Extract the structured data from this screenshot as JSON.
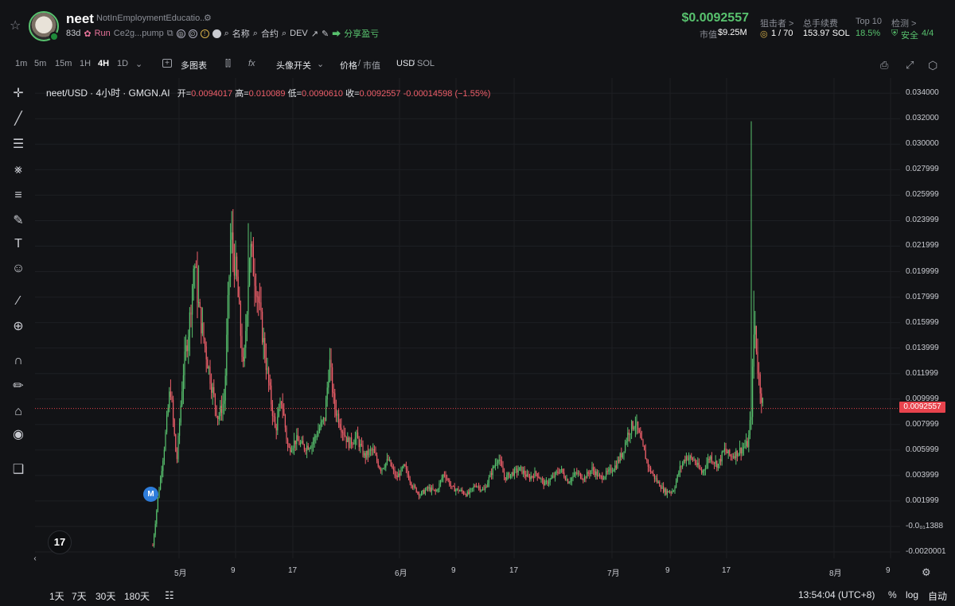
{
  "header": {
    "symbol": "neet",
    "full_name": "NotInEmploymentEducatio...",
    "age": "83d",
    "launchpad": "Run",
    "contract": "Ce2g...pump",
    "links": [
      "名称",
      "合约",
      "DEV"
    ],
    "share_label": "分享盈亏",
    "price": "$0.0092557",
    "mcap_label": "市值",
    "mcap_value": "$9.25M",
    "snipers_label": "狙击者 >",
    "snipers_value": "1 / 70",
    "fees_label": "总手续费",
    "fees_value": "153.97 SOL",
    "top10_label": "Top 10",
    "top10_value": "18.5%",
    "check_label": "检测 >",
    "safety_label": "安全",
    "safety_value": "4/4"
  },
  "toolbar": {
    "intervals": [
      "1m",
      "5m",
      "15m",
      "1H",
      "4H",
      "1D"
    ],
    "active_interval": "4H",
    "multi_chart": "多图表",
    "avatar_toggle": "头像开关",
    "price_label": "价格",
    "mcap_label": "市值",
    "usd_label": "USD",
    "sol_label": "SOL"
  },
  "ohlc": {
    "symbol": "neet/USD",
    "interval": "4小时",
    "source": "GMGN.AI",
    "open_label": "开=",
    "open": "0.0094017",
    "high_label": "高=",
    "high": "0.010089",
    "low_label": "低=",
    "low": "0.0090610",
    "close_label": "收=",
    "close": "0.0092557",
    "change": "-0.00014598",
    "change_pct": "(−1.55%)"
  },
  "chart_data": {
    "type": "candlestick",
    "ylim": [
      -0.0025,
      0.0352
    ],
    "y_ticks": [
      "0.034000",
      "0.032000",
      "0.030000",
      "0.027999",
      "0.025999",
      "0.023999",
      "0.021999",
      "0.019999",
      "0.017999",
      "0.015999",
      "0.013999",
      "0.011999",
      "0.009999",
      "0.007999",
      "0.005999",
      "0.003999",
      "0.001999",
      "-0.0₀₁1388",
      "-0.0020001"
    ],
    "x_ticks": [
      "5月",
      "9",
      "17",
      "6月",
      "9",
      "17",
      "7月",
      "9",
      "17",
      "8月",
      "9"
    ],
    "current_price": "0.0092557",
    "colors": {
      "up": "#58c26e",
      "down": "#ef5f6a",
      "bg": "#121316",
      "grid": "#1d1f23"
    },
    "path": [
      [
        0,
        -0.0015
      ],
      [
        6,
        0.002
      ],
      [
        14,
        0.006
      ],
      [
        22,
        0.011
      ],
      [
        30,
        0.005
      ],
      [
        38,
        0.012
      ],
      [
        46,
        0.016
      ],
      [
        52,
        0.021
      ],
      [
        58,
        0.017
      ],
      [
        66,
        0.014
      ],
      [
        74,
        0.011
      ],
      [
        82,
        0.0085
      ],
      [
        90,
        0.01
      ],
      [
        98,
        0.023
      ],
      [
        106,
        0.019
      ],
      [
        114,
        0.012
      ],
      [
        122,
        0.022
      ],
      [
        130,
        0.019
      ],
      [
        138,
        0.015
      ],
      [
        146,
        0.011
      ],
      [
        154,
        0.0075
      ],
      [
        162,
        0.01
      ],
      [
        170,
        0.006
      ],
      [
        180,
        0.0068
      ],
      [
        190,
        0.0062
      ],
      [
        200,
        0.0065
      ],
      [
        208,
        0.0075
      ],
      [
        216,
        0.0085
      ],
      [
        222,
        0.013
      ],
      [
        228,
        0.0095
      ],
      [
        236,
        0.008
      ],
      [
        246,
        0.0065
      ],
      [
        256,
        0.007
      ],
      [
        266,
        0.0055
      ],
      [
        276,
        0.006
      ],
      [
        286,
        0.0045
      ],
      [
        296,
        0.0052
      ],
      [
        306,
        0.0038
      ],
      [
        316,
        0.0047
      ],
      [
        326,
        0.0032
      ],
      [
        336,
        0.0025
      ],
      [
        346,
        0.003
      ],
      [
        356,
        0.0027
      ],
      [
        366,
        0.0042
      ],
      [
        376,
        0.003
      ],
      [
        386,
        0.0028
      ],
      [
        396,
        0.0025
      ],
      [
        406,
        0.0033
      ],
      [
        416,
        0.0028
      ],
      [
        426,
        0.0043
      ],
      [
        434,
        0.0055
      ],
      [
        442,
        0.0038
      ],
      [
        452,
        0.0042
      ],
      [
        462,
        0.0045
      ],
      [
        472,
        0.0038
      ],
      [
        482,
        0.0042
      ],
      [
        492,
        0.0033
      ],
      [
        502,
        0.0038
      ],
      [
        512,
        0.0045
      ],
      [
        522,
        0.0035
      ],
      [
        532,
        0.0042
      ],
      [
        542,
        0.0038
      ],
      [
        552,
        0.0045
      ],
      [
        562,
        0.0038
      ],
      [
        572,
        0.0042
      ],
      [
        582,
        0.0048
      ],
      [
        590,
        0.0058
      ],
      [
        598,
        0.0075
      ],
      [
        606,
        0.0082
      ],
      [
        614,
        0.0065
      ],
      [
        624,
        0.0045
      ],
      [
        634,
        0.0035
      ],
      [
        644,
        0.0027
      ],
      [
        654,
        0.0028
      ],
      [
        662,
        0.0045
      ],
      [
        670,
        0.0055
      ],
      [
        680,
        0.0052
      ],
      [
        690,
        0.0042
      ],
      [
        700,
        0.0055
      ],
      [
        710,
        0.0048
      ],
      [
        718,
        0.006
      ],
      [
        726,
        0.0055
      ],
      [
        734,
        0.0058
      ],
      [
        742,
        0.0062
      ],
      [
        748,
        0.0065
      ],
      [
        752,
        0.009
      ],
      [
        756,
        0.0165
      ],
      [
        760,
        0.0125
      ],
      [
        764,
        0.0105
      ],
      [
        768,
        0.0092557
      ]
    ],
    "spikes": [
      [
        752,
        0.0318
      ],
      [
        756,
        0.0185
      ],
      [
        98,
        0.0238
      ],
      [
        120,
        0.0238
      ],
      [
        52,
        0.0205
      ],
      [
        58,
        0.0205
      ]
    ]
  },
  "bottom": {
    "ranges": [
      "1天",
      "7天",
      "30天",
      "180天"
    ],
    "time": "13:54:04 (UTC+8)",
    "pct_label": "%",
    "log_label": "log",
    "auto_label": "自动"
  }
}
